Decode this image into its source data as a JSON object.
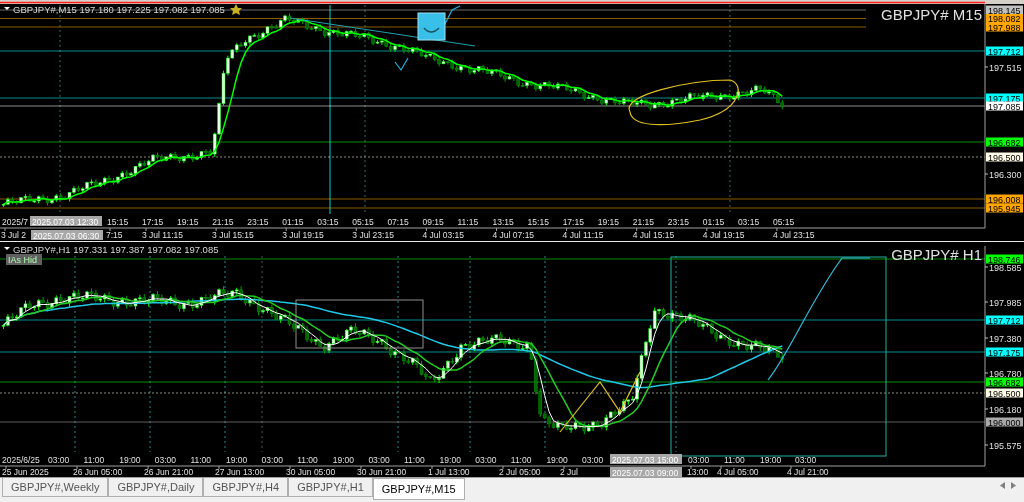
{
  "panes": [
    {
      "header": "GBPJPY#,M15 197.180 197.225 197.082 197.085",
      "title": "GBPJPY# M15",
      "price_labels": [
        {
          "text": "198.145",
          "kind": "tag",
          "color": "#c0c0c0"
        },
        {
          "text": "198.082",
          "kind": "tag",
          "color": "#ffa500"
        },
        {
          "text": "197.988",
          "kind": "tag",
          "color": "#ffa500"
        },
        {
          "text": "197.712",
          "kind": "tag",
          "color": "#00ffff"
        },
        {
          "text": "197.515",
          "kind": "tick"
        },
        {
          "text": "197.175",
          "kind": "tag",
          "color": "#00ffff"
        },
        {
          "text": "197.085",
          "kind": "tag",
          "color": "#ffffff"
        },
        {
          "text": "196.682",
          "kind": "tag",
          "color": "#00ff00"
        },
        {
          "text": "196.500",
          "kind": "tag",
          "color": "#fffbe6"
        },
        {
          "text": "196.300",
          "kind": "tick"
        },
        {
          "text": "196.008",
          "kind": "tag",
          "color": "#ffa500"
        },
        {
          "text": "195.945",
          "kind": "tag",
          "color": "#ffa500"
        }
      ],
      "time_axis": {
        "row_1": [
          "2025/7",
          "15:15",
          "17:15",
          "19:15",
          "21:15",
          "23:15",
          "01:15",
          "03:15",
          "05:15",
          "07:15",
          "09:15",
          "11:15",
          "13:15",
          "15:15",
          "17:15",
          "19:15",
          "21:15",
          "23:15",
          "01:15",
          "03:15",
          "05:15"
        ],
        "row_2": [
          "3 Jul 2",
          "7:15",
          "3 Jul 11:15",
          "3 Jul 15:15",
          "3 Jul 19:15",
          "3 Jul 23:15",
          "4 Jul 03:15",
          "4 Jul 07:15",
          "4 Jul 11:15",
          "4 Jul 15:15",
          "4 Jul 19:15",
          "4 Jul 23:15"
        ]
      },
      "crosshair_labels": [
        "2025.07.03 12:30",
        "2025.07.03 06:30"
      ]
    },
    {
      "header": "GBPJPY#,H1 197.331 197.387 197.082 197.085",
      "title": "GBPJPY# H1",
      "badge": "IAs Hid",
      "price_labels": [
        {
          "text": "198.746",
          "kind": "tag",
          "color": "#00ff00"
        },
        {
          "text": "198.585",
          "kind": "tick"
        },
        {
          "text": "197.985",
          "kind": "tick"
        },
        {
          "text": "197.712",
          "kind": "tag",
          "color": "#00ffff"
        },
        {
          "text": "197.380",
          "kind": "tick"
        },
        {
          "text": "197.175",
          "kind": "tag",
          "color": "#00ffff"
        },
        {
          "text": "196.780",
          "kind": "tick"
        },
        {
          "text": "196.682",
          "kind": "tag",
          "color": "#00ff00"
        },
        {
          "text": "196.500",
          "kind": "tag",
          "color": "#fffbe6"
        },
        {
          "text": "196.180",
          "kind": "tick"
        },
        {
          "text": "196.000",
          "kind": "tag",
          "color": "#a9a9a9"
        },
        {
          "text": "195.575",
          "kind": "tick"
        }
      ],
      "time_axis": {
        "row_1": [
          "2025/6/25",
          "03:00",
          "11:00",
          "19:00",
          "03:00",
          "11:00",
          "19:00",
          "03:00",
          "11:00",
          "19:00",
          "03:00",
          "11:00",
          "19:00",
          "03:00",
          "11:00",
          "19:00",
          "03:00",
          "03:00",
          "11:00",
          "19:00",
          "03:00"
        ],
        "row_2": [
          "25 Jun 2025",
          "26 Jun 05:00",
          "26 Jun 21:00",
          "27 Jun 13:00",
          "30 Jun 05:00",
          "30 Jun 21:00",
          "1 Jul 13:00",
          "2 Jul 05:00",
          "2 Jul",
          "13:00",
          "4 Jul 05:00",
          "4 Jul 21:00"
        ]
      },
      "crosshair_labels": [
        "2025.07.03 15:00",
        "2025.07.03 09:00"
      ]
    }
  ],
  "tabs": [
    {
      "label": "GBPJPY#,Weekly",
      "selected": false
    },
    {
      "label": "GBPJPY#,Daily",
      "selected": false
    },
    {
      "label": "GBPJPY#,H4",
      "selected": false
    },
    {
      "label": "GBPJPY#,H1",
      "selected": false
    },
    {
      "label": "GBPJPY#,M15",
      "selected": true
    }
  ]
}
